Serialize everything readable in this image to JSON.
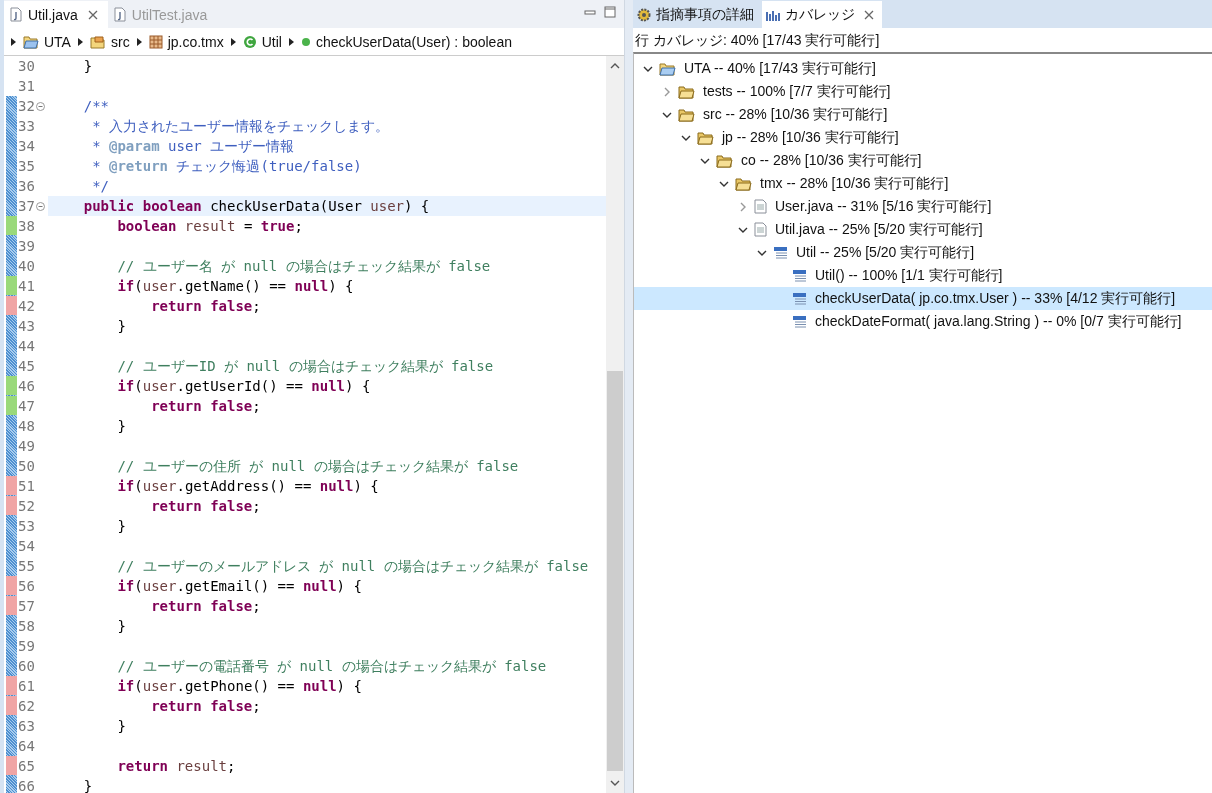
{
  "editor": {
    "tabs": [
      {
        "label": "Util.java",
        "selected": true
      },
      {
        "label": "UtilTest.java",
        "selected": false
      }
    ],
    "breadcrumb": [
      {
        "kind": "project",
        "label": "UTA"
      },
      {
        "kind": "source-folder",
        "label": "src"
      },
      {
        "kind": "package",
        "label": "jp.co.tmx"
      },
      {
        "kind": "class",
        "label": "Util"
      },
      {
        "kind": "method",
        "label": "checkUserData(User) : boolean"
      }
    ],
    "lines": [
      {
        "number": "30",
        "ruler": false,
        "fold": false,
        "current": false,
        "tokens": [
          {
            "t": "    }",
            "kind": "plain"
          }
        ]
      },
      {
        "number": "31",
        "ruler": false,
        "fold": false,
        "current": false
      },
      {
        "number": "32",
        "ruler": true,
        "fold": true,
        "current": false,
        "tokens": [
          {
            "t": "    /**",
            "kind": "doc"
          }
        ]
      },
      {
        "number": "33",
        "ruler": true,
        "fold": false,
        "current": false,
        "tokens": [
          {
            "t": "     * 入力されたユーザー情報をチェックします。",
            "kind": "doc"
          }
        ]
      },
      {
        "number": "34",
        "ruler": true,
        "fold": false,
        "current": false,
        "tokens": [
          {
            "t": "     * ",
            "kind": "doc"
          },
          {
            "t": "@param",
            "kind": "doctag"
          },
          {
            "t": " user ユーザー情報",
            "kind": "doc"
          }
        ]
      },
      {
        "number": "35",
        "ruler": true,
        "fold": false,
        "current": false,
        "tokens": [
          {
            "t": "     * ",
            "kind": "doc"
          },
          {
            "t": "@return",
            "kind": "doctag"
          },
          {
            "t": " チェック悔過(true/false)",
            "kind": "doc"
          }
        ]
      },
      {
        "number": "36",
        "ruler": true,
        "fold": false,
        "current": false,
        "tokens": [
          {
            "t": "     */",
            "kind": "doc"
          }
        ]
      },
      {
        "number": "37",
        "ruler": true,
        "fold": true,
        "current": true,
        "tokens": [
          {
            "t": "    public boolean",
            "kind": "kw"
          },
          {
            "t": " checkUserData(User ",
            "kind": "plain"
          },
          {
            "t": "user",
            "kind": "var"
          },
          {
            "t": ") {",
            "kind": "plain"
          }
        ]
      },
      {
        "number": "38",
        "ruler": true,
        "color": "#9ad97a",
        "fold": false,
        "current": false,
        "tokens": [
          {
            "t": "        boolean",
            "kind": "kw"
          },
          {
            "t": " result",
            "kind": "var"
          },
          {
            "t": " = ",
            "kind": "plain"
          },
          {
            "t": "true",
            "kind": "kw"
          },
          {
            "t": ";",
            "kind": "plain"
          }
        ]
      },
      {
        "number": "39",
        "ruler": true,
        "fold": false,
        "current": false
      },
      {
        "number": "40",
        "ruler": true,
        "fold": false,
        "current": false,
        "tokens": [
          {
            "t": "        // ユーザー名 が null の場合はチェック結果が false",
            "kind": "comment"
          }
        ]
      },
      {
        "number": "41",
        "ruler": true,
        "color": "#9ad97a",
        "fold": false,
        "current": false,
        "tokens": [
          {
            "t": "        if",
            "kind": "kw"
          },
          {
            "t": "(",
            "kind": "plain"
          },
          {
            "t": "user",
            "kind": "var"
          },
          {
            "t": ".getName() == ",
            "kind": "plain"
          },
          {
            "t": "null",
            "kind": "kw"
          },
          {
            "t": ") {",
            "kind": "plain"
          }
        ]
      },
      {
        "number": "42",
        "ruler": true,
        "color": "#f0a5a5",
        "fold": false,
        "current": false,
        "tokens": [
          {
            "t": "            return false",
            "kind": "kw"
          },
          {
            "t": ";",
            "kind": "plain"
          }
        ]
      },
      {
        "number": "43",
        "ruler": true,
        "fold": false,
        "current": false,
        "tokens": [
          {
            "t": "        }",
            "kind": "plain"
          }
        ]
      },
      {
        "number": "44",
        "ruler": true,
        "fold": false,
        "current": false
      },
      {
        "number": "45",
        "ruler": true,
        "fold": false,
        "current": false,
        "tokens": [
          {
            "t": "        // ユーザーID が null の場合はチェック結果が false",
            "kind": "comment"
          }
        ]
      },
      {
        "number": "46",
        "ruler": true,
        "color": "#9ad97a",
        "fold": false,
        "current": false,
        "tokens": [
          {
            "t": "        if",
            "kind": "kw"
          },
          {
            "t": "(",
            "kind": "plain"
          },
          {
            "t": "user",
            "kind": "var"
          },
          {
            "t": ".getUserId() == ",
            "kind": "plain"
          },
          {
            "t": "null",
            "kind": "kw"
          },
          {
            "t": ") {",
            "kind": "plain"
          }
        ]
      },
      {
        "number": "47",
        "ruler": true,
        "color": "#9ad97a",
        "fold": false,
        "current": false,
        "tokens": [
          {
            "t": "            return false",
            "kind": "kw"
          },
          {
            "t": ";",
            "kind": "plain"
          }
        ]
      },
      {
        "number": "48",
        "ruler": true,
        "fold": false,
        "current": false,
        "tokens": [
          {
            "t": "        }",
            "kind": "plain"
          }
        ]
      },
      {
        "number": "49",
        "ruler": true,
        "fold": false,
        "current": false
      },
      {
        "number": "50",
        "ruler": true,
        "fold": false,
        "current": false,
        "tokens": [
          {
            "t": "        // ユーザーの住所 が null の場合はチェック結果が false",
            "kind": "comment"
          }
        ]
      },
      {
        "number": "51",
        "ruler": true,
        "color": "#f0a5a5",
        "fold": false,
        "current": false,
        "tokens": [
          {
            "t": "        if",
            "kind": "kw"
          },
          {
            "t": "(",
            "kind": "plain"
          },
          {
            "t": "user",
            "kind": "var"
          },
          {
            "t": ".getAddress() == ",
            "kind": "plain"
          },
          {
            "t": "null",
            "kind": "kw"
          },
          {
            "t": ") {",
            "kind": "plain"
          }
        ]
      },
      {
        "number": "52",
        "ruler": true,
        "color": "#f0a5a5",
        "fold": false,
        "current": false,
        "tokens": [
          {
            "t": "            return false",
            "kind": "kw"
          },
          {
            "t": ";",
            "kind": "plain"
          }
        ]
      },
      {
        "number": "53",
        "ruler": true,
        "fold": false,
        "current": false,
        "tokens": [
          {
            "t": "        }",
            "kind": "plain"
          }
        ]
      },
      {
        "number": "54",
        "ruler": true,
        "fold": false,
        "current": false
      },
      {
        "number": "55",
        "ruler": true,
        "fold": false,
        "current": false,
        "tokens": [
          {
            "t": "        // ユーザーのメールアドレス が null の場合はチェック結果が false",
            "kind": "comment"
          }
        ]
      },
      {
        "number": "56",
        "ruler": true,
        "color": "#f0a5a5",
        "fold": false,
        "current": false,
        "tokens": [
          {
            "t": "        if",
            "kind": "kw"
          },
          {
            "t": "(",
            "kind": "plain"
          },
          {
            "t": "user",
            "kind": "var"
          },
          {
            "t": ".getEmail() == ",
            "kind": "plain"
          },
          {
            "t": "null",
            "kind": "kw"
          },
          {
            "t": ") {",
            "kind": "plain"
          }
        ]
      },
      {
        "number": "57",
        "ruler": true,
        "color": "#f0a5a5",
        "fold": false,
        "current": false,
        "tokens": [
          {
            "t": "            return false",
            "kind": "kw"
          },
          {
            "t": ";",
            "kind": "plain"
          }
        ]
      },
      {
        "number": "58",
        "ruler": true,
        "fold": false,
        "current": false,
        "tokens": [
          {
            "t": "        }",
            "kind": "plain"
          }
        ]
      },
      {
        "number": "59",
        "ruler": true,
        "fold": false,
        "current": false
      },
      {
        "number": "60",
        "ruler": true,
        "fold": false,
        "current": false,
        "tokens": [
          {
            "t": "        // ユーザーの電話番号 が null の場合はチェック結果が false",
            "kind": "comment"
          }
        ]
      },
      {
        "number": "61",
        "ruler": true,
        "color": "#f0a5a5",
        "fold": false,
        "current": false,
        "tokens": [
          {
            "t": "        if",
            "kind": "kw"
          },
          {
            "t": "(",
            "kind": "plain"
          },
          {
            "t": "user",
            "kind": "var"
          },
          {
            "t": ".getPhone() == ",
            "kind": "plain"
          },
          {
            "t": "null",
            "kind": "kw"
          },
          {
            "t": ") {",
            "kind": "plain"
          }
        ]
      },
      {
        "number": "62",
        "ruler": true,
        "color": "#f0a5a5",
        "fold": false,
        "current": false,
        "tokens": [
          {
            "t": "            return false",
            "kind": "kw"
          },
          {
            "t": ";",
            "kind": "plain"
          }
        ]
      },
      {
        "number": "63",
        "ruler": true,
        "fold": false,
        "current": false,
        "tokens": [
          {
            "t": "        }",
            "kind": "plain"
          }
        ]
      },
      {
        "number": "64",
        "ruler": true,
        "fold": false,
        "current": false
      },
      {
        "number": "65",
        "ruler": true,
        "color": "#f0a5a5",
        "fold": false,
        "current": false,
        "tokens": [
          {
            "t": "        return",
            "kind": "kw"
          },
          {
            "t": " result",
            "kind": "var"
          },
          {
            "t": ";",
            "kind": "plain"
          }
        ]
      },
      {
        "number": "66",
        "ruler": true,
        "fold": false,
        "current": false,
        "tokens": [
          {
            "t": "    }",
            "kind": "plain"
          }
        ]
      }
    ]
  },
  "coverage_view": {
    "tabs": [
      {
        "label": "指摘事項の詳細",
        "selected": false
      },
      {
        "label": "カバレッジ",
        "selected": true
      }
    ],
    "summary": "行 カバレッジ: 40% [17/43 実行可能行]",
    "tree": [
      {
        "label": "UTA -- 40% [17/43 実行可能行]",
        "kind": "project",
        "expanded": true,
        "selected": false,
        "children": [
          {
            "label": "tests -- 100% [7/7 実行可能行]",
            "kind": "folder",
            "expanded": false,
            "selected": false
          },
          {
            "label": "src -- 28% [10/36 実行可能行]",
            "kind": "folder",
            "expanded": true,
            "selected": false,
            "children": [
              {
                "label": "jp -- 28% [10/36 実行可能行]",
                "kind": "folder",
                "expanded": true,
                "selected": false,
                "children": [
                  {
                    "label": "co -- 28% [10/36 実行可能行]",
                    "kind": "folder",
                    "expanded": true,
                    "selected": false,
                    "children": [
                      {
                        "label": "tmx -- 28% [10/36 実行可能行]",
                        "kind": "folder",
                        "expanded": true,
                        "selected": false,
                        "children": [
                          {
                            "label": "User.java -- 31% [5/16 実行可能行]",
                            "kind": "file",
                            "expanded": false,
                            "selected": false
                          },
                          {
                            "label": "Util.java -- 25% [5/20 実行可能行]",
                            "kind": "file",
                            "expanded": true,
                            "selected": false,
                            "children": [
                              {
                                "label": "Util -- 25% [5/20 実行可能行]",
                                "kind": "class",
                                "expanded": true,
                                "selected": false,
                                "children": [
                                  {
                                    "label": "Util() -- 100% [1/1 実行可能行]",
                                    "kind": "method",
                                    "selected": false
                                  },
                                  {
                                    "label": "checkUserData( jp.co.tmx.User ) -- 33% [4/12 実行可能行]",
                                    "kind": "method",
                                    "selected": true
                                  },
                                  {
                                    "label": "checkDateFormat( java.lang.String ) -- 0% [0/7 実行可能行]",
                                    "kind": "method",
                                    "selected": false
                                  }
                                ]
                              }
                            ]
                          }
                        ]
                      }
                    ]
                  }
                ]
              }
            ]
          }
        ]
      }
    ]
  }
}
